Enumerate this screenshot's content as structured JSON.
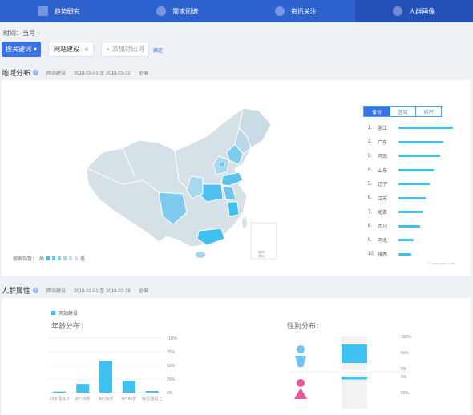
{
  "nav": {
    "tabs": [
      {
        "label": "趋势研究",
        "icon": "chart-icon",
        "active": false
      },
      {
        "label": "需求图谱",
        "icon": "sun-icon",
        "active": false
      },
      {
        "label": "资讯关注",
        "icon": "moon-icon",
        "active": false
      },
      {
        "label": "人群画像",
        "icon": "users-icon",
        "active": true
      }
    ]
  },
  "time_filter": "时间：当月 ›",
  "toolbar": {
    "by_keyword_label": "按关键词",
    "keyword": "网站建设",
    "add_compare_label": "+ 添加对比词",
    "confirm_label": "确定"
  },
  "region": {
    "title": "地域分布",
    "keyword": "网站建设",
    "date_range": "2018-03-01 至 2018-03-22",
    "scope": "全国",
    "scale_label": "搜索指数：",
    "scale_high": "高",
    "scale_low": "低",
    "inset_label_1": "南海",
    "inset_label_2": "诸岛",
    "tabs": [
      "省份",
      "区域",
      "城市"
    ],
    "active_tab": 0,
    "ranking": [
      {
        "rank": "1.",
        "name": "浙江",
        "value": 100
      },
      {
        "rank": "2.",
        "name": "广东",
        "value": 82
      },
      {
        "rank": "3.",
        "name": "河南",
        "value": 77
      },
      {
        "rank": "4.",
        "name": "山东",
        "value": 65
      },
      {
        "rank": "5.",
        "name": "辽宁",
        "value": 58
      },
      {
        "rank": "6.",
        "name": "江苏",
        "value": 50
      },
      {
        "rank": "7.",
        "name": "北京",
        "value": 46
      },
      {
        "rank": "8.",
        "name": "四川",
        "value": 39
      },
      {
        "rank": "9.",
        "name": "河北",
        "value": 28
      },
      {
        "rank": "10.",
        "name": "陕西",
        "value": 24
      }
    ],
    "watermark": "© index.baidu.com",
    "colors": {
      "bar": "#3fc1f0",
      "map_base": "#d5e0e7",
      "map_mid": "#a9d8ec",
      "map_high": "#3fc1f0"
    }
  },
  "people": {
    "title": "人群属性",
    "keyword": "网站建设",
    "date_range": "2018-02-01 至 2018-02-28",
    "scope": "全国",
    "legend": "网站建设",
    "age_title": "年龄分布：",
    "gender_title": "性别分布：",
    "age_y_ticks": [
      "100%",
      "75%",
      "50%",
      "25%",
      "0%"
    ],
    "gender_y_ticks_male": [
      "100%",
      "50%",
      "0%"
    ],
    "gender_y_ticks_female": [
      "0%",
      "50%"
    ]
  },
  "chart_data": [
    {
      "type": "bar",
      "categories": [
        "19岁及以下",
        "20~29岁",
        "30~39岁",
        "40~49岁",
        "50岁及以上"
      ],
      "series": [
        {
          "name": "网站建设",
          "values": [
            2,
            16,
            58,
            22,
            3
          ]
        }
      ],
      "ylim": [
        0,
        100
      ],
      "ylabel": "",
      "xlabel": "",
      "title": "年龄分布："
    },
    {
      "type": "bar",
      "categories": [
        "男",
        "女"
      ],
      "series": [
        {
          "name": "网站建设",
          "values": [
            72,
            28
          ]
        }
      ],
      "ylim": [
        0,
        100
      ],
      "title": "性别分布："
    }
  ]
}
